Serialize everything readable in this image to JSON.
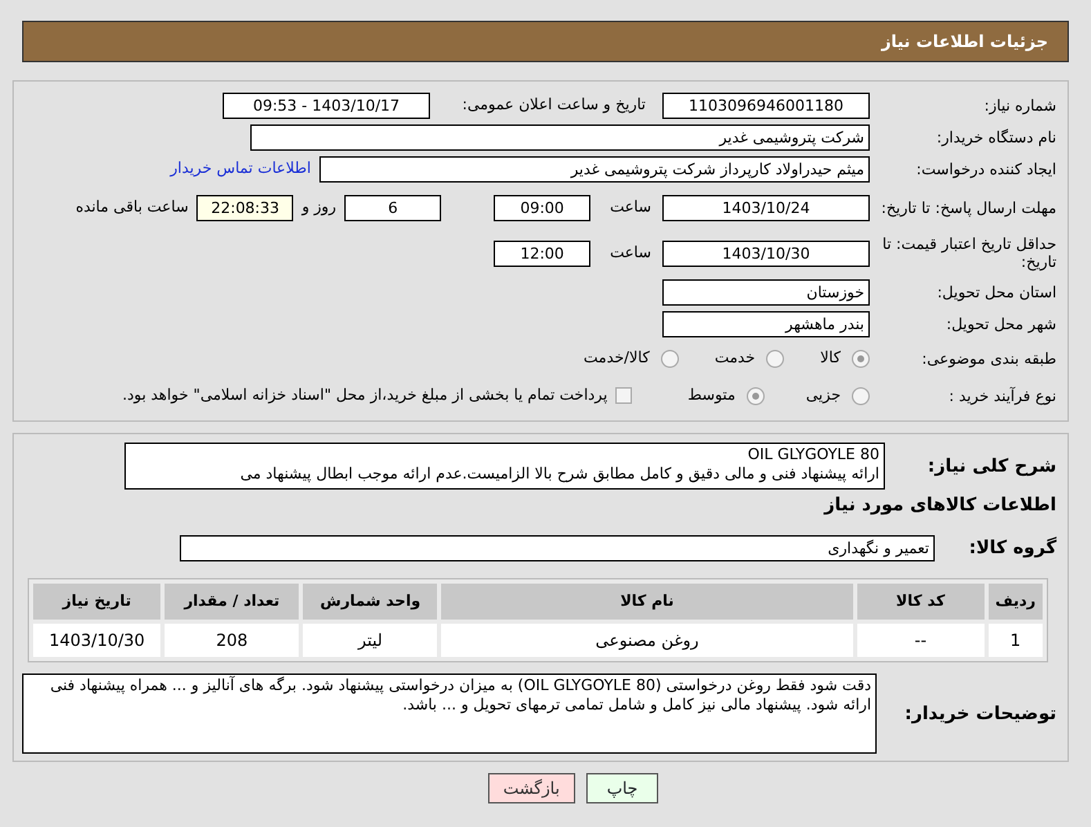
{
  "header": {
    "title": "جزئیات اطلاعات نیاز"
  },
  "need_number": {
    "label": "شماره نیاز:",
    "value": "1103096946001180"
  },
  "announce": {
    "label": "تاریخ و ساعت اعلان عمومی:",
    "value": "1403/10/17 - 09:53"
  },
  "buyer_org": {
    "label": "نام دستگاه خریدار:",
    "value": "شرکت پتروشیمی غدیر"
  },
  "creator": {
    "label": "ایجاد کننده درخواست:",
    "value": "میثم حیدراولاد کارپرداز شرکت پتروشیمی غدیر",
    "link": "اطلاعات تماس خریدار"
  },
  "reply_deadline": {
    "label": "مهلت ارسال پاسخ: تا تاریخ:",
    "date": "1403/10/24",
    "time_label": "ساعت",
    "time": "09:00",
    "days": "6",
    "days_label": "روز و",
    "remaining": "22:08:33",
    "remaining_label": "ساعت باقی مانده"
  },
  "price_validity": {
    "label": "حداقل تاریخ اعتبار قیمت: تا تاریخ:",
    "date": "1403/10/30",
    "time_label": "ساعت",
    "time": "12:00"
  },
  "province": {
    "label": "استان محل تحویل:",
    "value": "خوزستان"
  },
  "city": {
    "label": "شهر محل تحویل:",
    "value": "بندر ماهشهر"
  },
  "category": {
    "label": "طبقه بندی موضوعی:",
    "options": [
      {
        "label": "کالا",
        "selected": true
      },
      {
        "label": "خدمت",
        "selected": false
      },
      {
        "label": "کالا/خدمت",
        "selected": false
      }
    ]
  },
  "process": {
    "label": "نوع فرآیند خرید :",
    "options": [
      {
        "label": "جزیی",
        "selected": false
      },
      {
        "label": "متوسط",
        "selected": true
      }
    ],
    "payment_checkbox": {
      "checked": false,
      "label": "پرداخت تمام یا بخشی از مبلغ خرید،از محل \"اسناد خزانه اسلامی\" خواهد بود."
    }
  },
  "description": {
    "label": "شرح کلی نیاز:",
    "lines": [
      "OIL GLYGOYLE 80",
      "ارائه پیشنهاد فنی و مالی دقیق و کامل مطابق شرح بالا الزامیست.عدم ارائه موجب ابطال پیشنهاد می"
    ]
  },
  "goods": {
    "title": "اطلاعات کالاهای مورد نیاز",
    "group_label": "گروه کالا:",
    "group_value": "تعمیر و نگهداری",
    "table": {
      "columns": [
        "ردیف",
        "کد کالا",
        "نام کالا",
        "واحد شمارش",
        "تعداد / مقدار",
        "تاریخ نیاز"
      ],
      "rows": [
        [
          "1",
          "--",
          "روغن مصنوعی",
          "لیتر",
          "208",
          "1403/10/30"
        ]
      ]
    }
  },
  "buyer_notes": {
    "label": "توضیحات خریدار:",
    "text": "دقت شود فقط روغن درخواستی (OIL GLYGOYLE 80) به میزان درخواستی پیشنهاد شود. برگه های آنالیز و ... همراه پیشنهاد فنی ارائه شود. پیشنهاد مالی نیز کامل و شامل تمامی ترمهای تحویل و ... باشد."
  },
  "buttons": [
    {
      "label": "چاپ",
      "kind": "print"
    },
    {
      "label": "بازگشت",
      "kind": "back"
    }
  ]
}
